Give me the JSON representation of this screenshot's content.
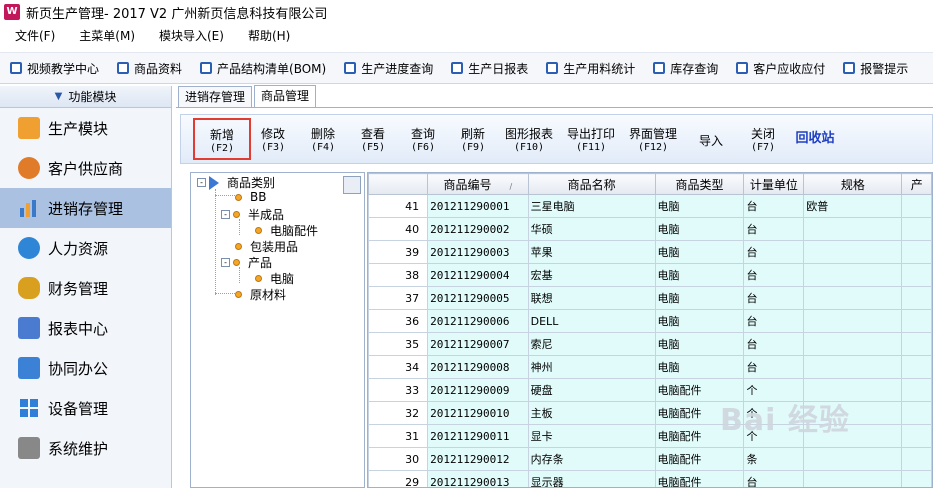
{
  "window": {
    "title": "新页生产管理- 2017 V2 广州新页信息科技有限公司",
    "icon_text": "W"
  },
  "menu": [
    "文件(F)",
    "主菜单(M)",
    "模块导入(E)",
    "帮助(H)"
  ],
  "toolbar": [
    "视频教学中心",
    "商品资料",
    "产品结构清单(BOM)",
    "生产进度查询",
    "生产日报表",
    "生产用料统计",
    "库存查询",
    "客户应收应付",
    "报警提示"
  ],
  "sidebar": {
    "header": "功能模块",
    "items": [
      {
        "label": "生产模块",
        "icon": "folder-icon",
        "color": "#f0a030"
      },
      {
        "label": "客户供应商",
        "icon": "users-icon",
        "color": "#e07b2a"
      },
      {
        "label": "进销存管理",
        "icon": "bar-chart-icon",
        "color": "#3a78c8"
      },
      {
        "label": "人力资源",
        "icon": "person-icon",
        "color": "#2f86d6"
      },
      {
        "label": "财务管理",
        "icon": "money-bag-icon",
        "color": "#d9a020"
      },
      {
        "label": "报表中心",
        "icon": "report-icon",
        "color": "#4a7bd0"
      },
      {
        "label": "协同办公",
        "icon": "calendar-icon",
        "color": "#3b82d6"
      },
      {
        "label": "设备管理",
        "icon": "grid-icon",
        "color": "#2f7fd8"
      },
      {
        "label": "系统维护",
        "icon": "lock-icon",
        "color": "#888888"
      }
    ]
  },
  "tabs": [
    "进销存管理",
    "商品管理"
  ],
  "actions": [
    {
      "label": "新增",
      "key": "(F2)"
    },
    {
      "label": "修改",
      "key": "(F3)"
    },
    {
      "label": "删除",
      "key": "(F4)"
    },
    {
      "label": "查看",
      "key": "(F5)"
    },
    {
      "label": "查询",
      "key": "(F6)"
    },
    {
      "label": "刷新",
      "key": "(F9)"
    },
    {
      "label": "图形报表",
      "key": "(F10)"
    },
    {
      "label": "导出打印",
      "key": "(F11)"
    },
    {
      "label": "界面管理",
      "key": "(F12)"
    },
    {
      "label": "导入",
      "key": ""
    },
    {
      "label": "关闭",
      "key": "(F7)"
    },
    {
      "label": "回收站",
      "key": ""
    }
  ],
  "tree": {
    "root": "商品类别",
    "nodes": [
      "BB",
      "半成品",
      "电脑配件",
      "包装用品",
      "产品",
      "电脑",
      "原材料"
    ]
  },
  "grid": {
    "columns": [
      "商品编号",
      "商品名称",
      "商品类型",
      "计量单位",
      "规格",
      "产"
    ],
    "rows": [
      [
        "41",
        "201211290001",
        "三星电脑",
        "电脑",
        "台",
        "欧普"
      ],
      [
        "40",
        "201211290002",
        "华硕",
        "电脑",
        "台",
        ""
      ],
      [
        "39",
        "201211290003",
        "苹果",
        "电脑",
        "台",
        ""
      ],
      [
        "38",
        "201211290004",
        "宏基",
        "电脑",
        "台",
        ""
      ],
      [
        "37",
        "201211290005",
        "联想",
        "电脑",
        "台",
        ""
      ],
      [
        "36",
        "201211290006",
        "DELL",
        "电脑",
        "台",
        ""
      ],
      [
        "35",
        "201211290007",
        "索尼",
        "电脑",
        "台",
        ""
      ],
      [
        "34",
        "201211290008",
        "神州",
        "电脑",
        "台",
        ""
      ],
      [
        "33",
        "201211290009",
        "硬盘",
        "电脑配件",
        "个",
        ""
      ],
      [
        "32",
        "201211290010",
        "主板",
        "电脑配件",
        "个",
        ""
      ],
      [
        "31",
        "201211290011",
        "显卡",
        "电脑配件",
        "个",
        ""
      ],
      [
        "30",
        "201211290012",
        "内存条",
        "电脑配件",
        "条",
        ""
      ],
      [
        "29",
        "201211290013",
        "显示器",
        "电脑配件",
        "台",
        ""
      ]
    ]
  },
  "watermark": "Bai 经验"
}
